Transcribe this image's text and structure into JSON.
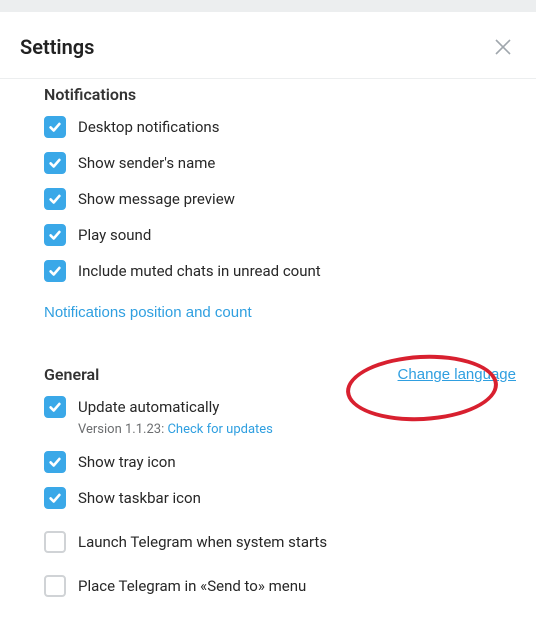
{
  "header": {
    "title": "Settings"
  },
  "sections": {
    "notifications": {
      "title": "Notifications",
      "desktop": "Desktop notifications",
      "sender": "Show sender's name",
      "preview": "Show message preview",
      "sound": "Play sound",
      "muted": "Include muted chats in unread count",
      "position_link": "Notifications position and count"
    },
    "general": {
      "title": "General",
      "change_lang": "Change language",
      "update_auto": "Update automatically",
      "version_prefix": "Version 1.1.23: ",
      "check_updates": "Check for updates",
      "tray": "Show tray icon",
      "taskbar": "Show taskbar icon",
      "launch": "Launch Telegram when system starts",
      "sendto": "Place Telegram in «Send to» menu"
    }
  }
}
